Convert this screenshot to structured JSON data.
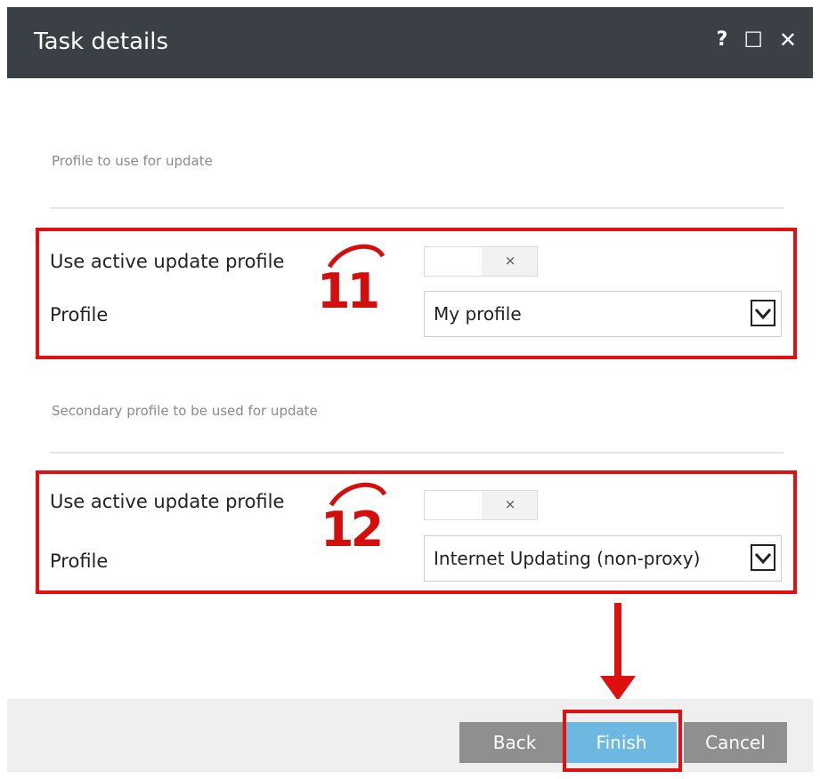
{
  "window": {
    "title": "Task details",
    "help_icon": "?",
    "maximize_icon": "☐",
    "close_icon": "✕"
  },
  "primary": {
    "section_title": "Profile to use for update",
    "use_active_label": "Use active update profile",
    "toggle_state_symbol": "×",
    "profile_label": "Profile",
    "profile_value": "My profile"
  },
  "secondary": {
    "section_title": "Secondary profile to be used for update",
    "use_active_label": "Use active update profile",
    "toggle_state_symbol": "×",
    "profile_label": "Profile",
    "profile_value": "Internet Updating (non-proxy)"
  },
  "annotations": {
    "step_11": "11",
    "step_12": "12",
    "highlight_color": "#e11111"
  },
  "footer": {
    "back_label": "Back",
    "finish_label": "Finish",
    "cancel_label": "Cancel"
  }
}
